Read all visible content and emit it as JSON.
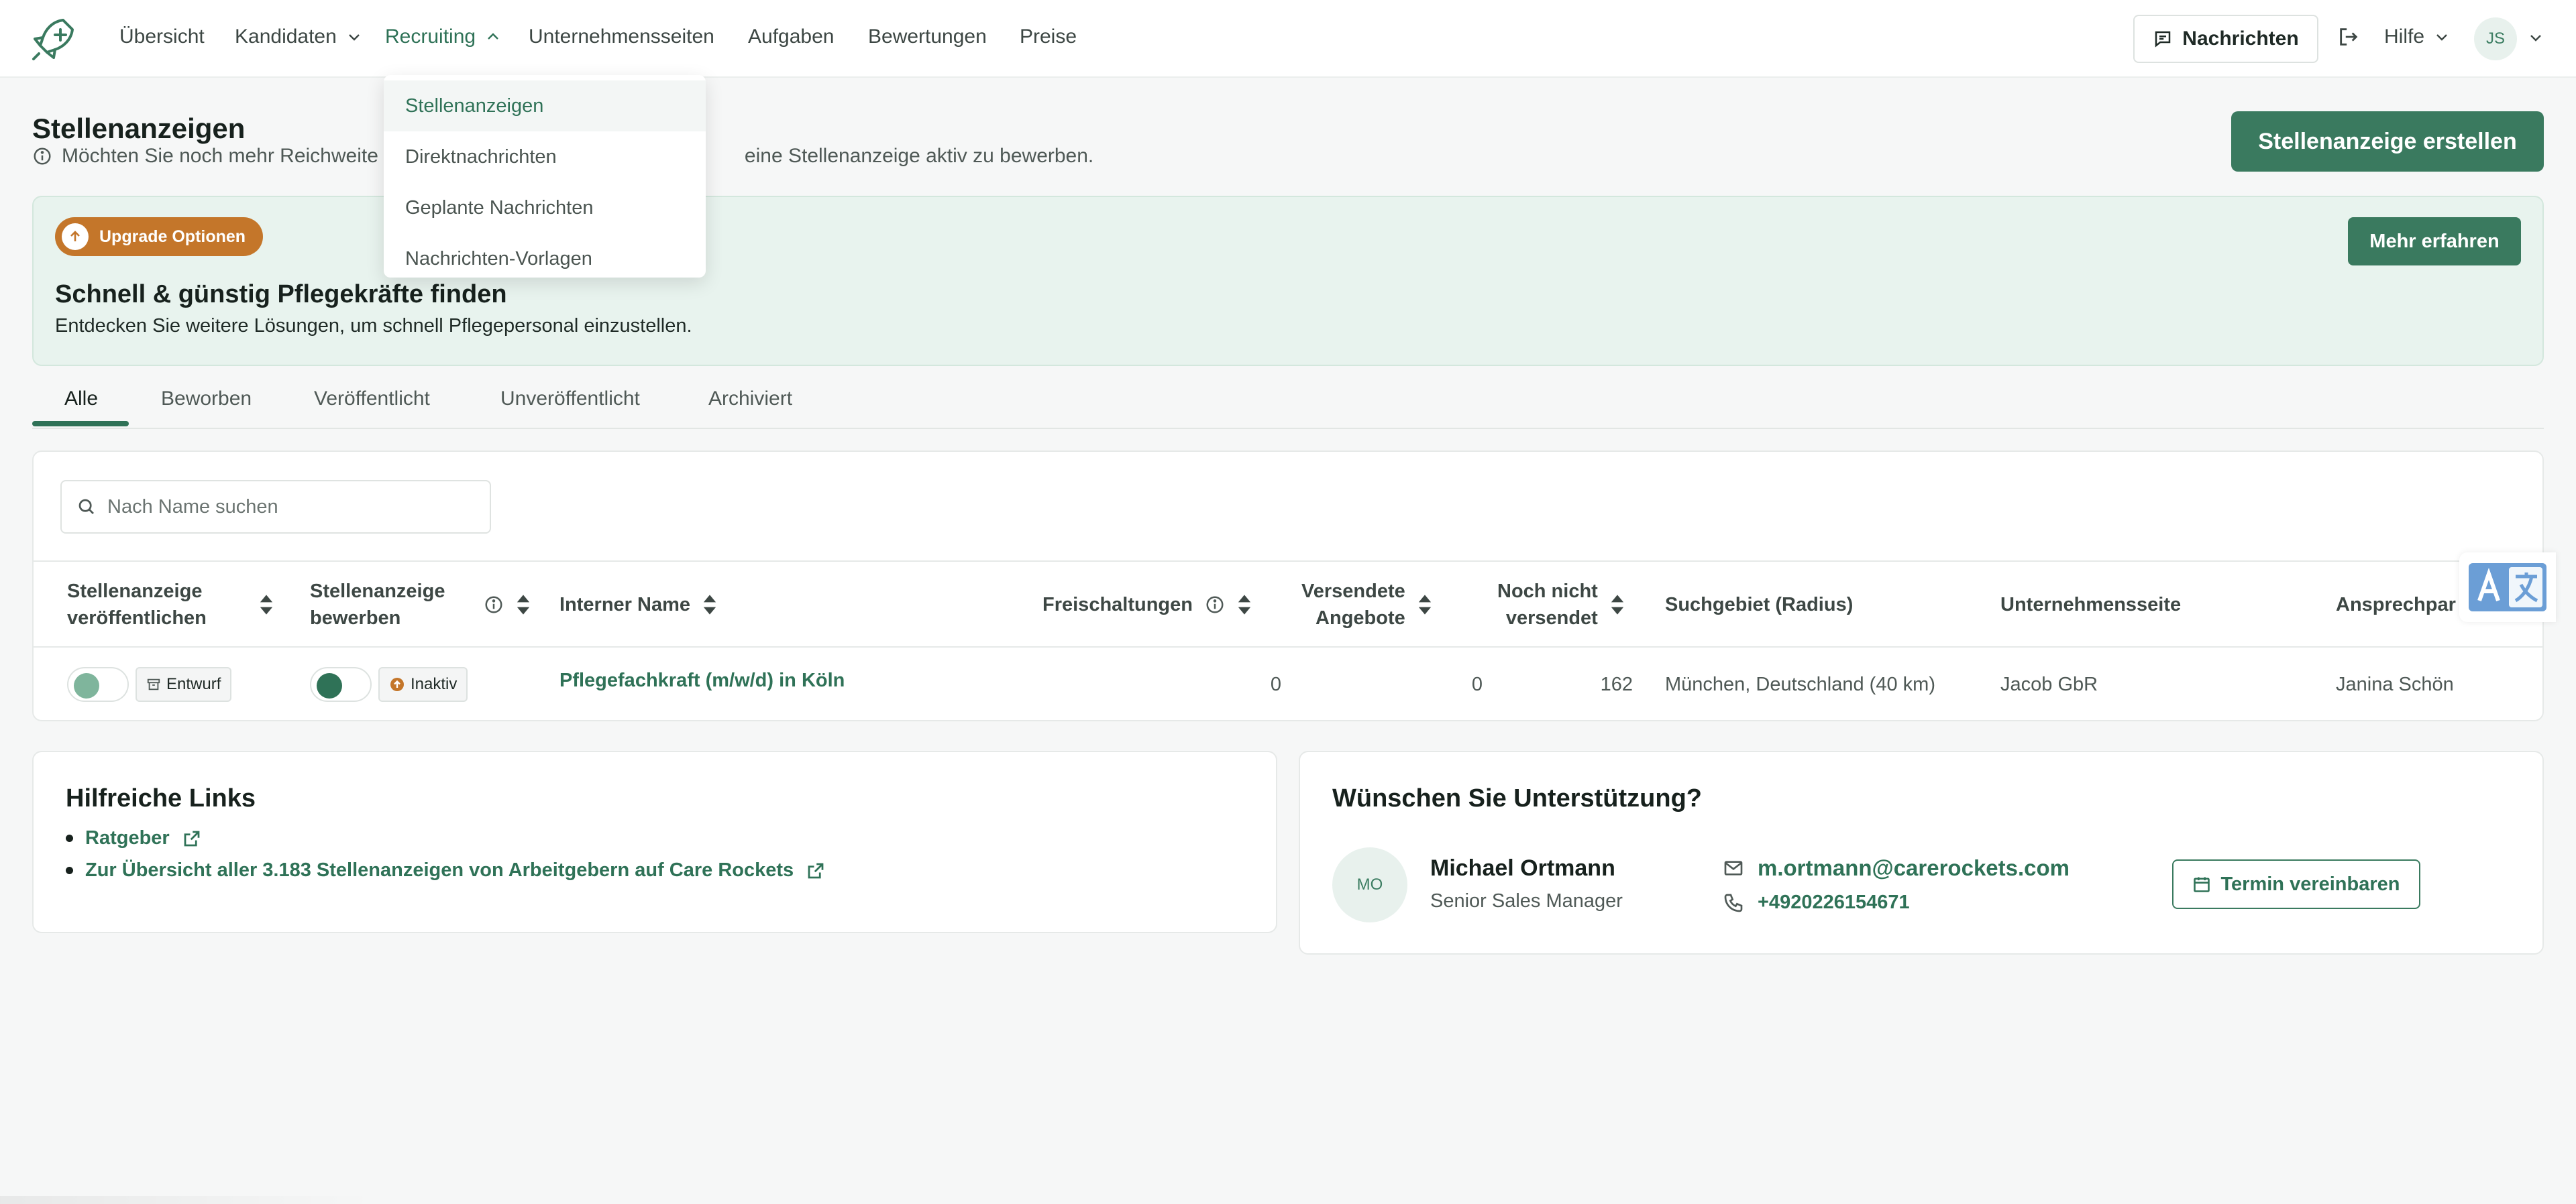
{
  "nav": {
    "items": [
      {
        "label": "Übersicht"
      },
      {
        "label": "Kandidaten"
      },
      {
        "label": "Recruiting"
      },
      {
        "label": "Unternehmensseiten"
      },
      {
        "label": "Aufgaben"
      },
      {
        "label": "Bewertungen"
      },
      {
        "label": "Preise"
      }
    ],
    "messages_label": "Nachrichten",
    "help_label": "Hilfe",
    "user_initials": "JS"
  },
  "recruiting_menu": [
    {
      "label": "Stellenanzeigen",
      "selected": true
    },
    {
      "label": "Direktnachrichten"
    },
    {
      "label": "Geplante Nachrichten"
    },
    {
      "label": "Nachrichten-Vorlagen"
    }
  ],
  "header": {
    "title": "Stellenanzeigen",
    "info_start": "Möchten Sie noch mehr Reichweite zu",
    "info_end": "eine Stellenanzeige aktiv zu bewerben.",
    "create_label": "Stellenanzeige erstellen"
  },
  "banner": {
    "badge": "Upgrade Optionen",
    "title": "Schnell & günstig Pflegekräfte finden",
    "subtitle": "Entdecken Sie weitere Lösungen, um schnell Pflegepersonal einzustellen.",
    "more_label": "Mehr erfahren"
  },
  "tabs": [
    {
      "label": "Alle",
      "active": true
    },
    {
      "label": "Beworben"
    },
    {
      "label": "Veröffentlicht"
    },
    {
      "label": "Unveröffentlicht"
    },
    {
      "label": "Archiviert"
    }
  ],
  "table": {
    "search_placeholder": "Nach Name suchen",
    "headers": {
      "publish": [
        "Stellenanzeige",
        "veröffentlichen"
      ],
      "promote": [
        "Stellenanzeige",
        "bewerben"
      ],
      "internal_name": "Interner Name",
      "unlocks": "Freischaltungen",
      "sent_offers": [
        "Versendete",
        "Angebote"
      ],
      "not_sent": [
        "Noch nicht",
        "versendet"
      ],
      "search_area": "Suchgebiet (Radius)",
      "company_page": "Unternehmensseite",
      "contact": "Ansprechpar"
    },
    "rows": [
      {
        "publish_status": "Entwurf",
        "promote_status": "Inaktiv",
        "internal_name": "Pflegefachkraft (m/w/d) in Köln",
        "unlocks": "0",
        "sent_offers": "0",
        "not_sent": "162",
        "search_area": "München, Deutschland (40 km)",
        "company_page": "Jacob GbR",
        "contact": "Janina Schön"
      }
    ]
  },
  "links_card": {
    "title": "Hilfreiche Links",
    "links": [
      {
        "label": "Ratgeber"
      },
      {
        "label": "Zur Übersicht aller 3.183 Stellenanzeigen von Arbeitgebern auf Care Rockets"
      }
    ]
  },
  "support_card": {
    "title": "Wünschen Sie Unterstützung?",
    "initials": "MO",
    "name": "Michael Ortmann",
    "role": "Senior Sales Manager",
    "email": "m.ortmann@carerockets.com",
    "phone": "+4920226154671",
    "appointment_label": "Termin vereinbaren"
  },
  "colors": {
    "brand_green": "#3a7a5f",
    "link_green": "#2f7257",
    "upgrade_orange": "#c4762a",
    "banner_bg": "#e8f3ee"
  },
  "icons": [
    "rocket-logo-icon",
    "chevron-down-icon",
    "chevron-up-icon",
    "message-icon",
    "logout-icon",
    "info-icon",
    "arrow-up-icon",
    "search-icon",
    "sort-icon",
    "archive-icon",
    "external-link-icon",
    "mail-icon",
    "phone-icon",
    "calendar-icon",
    "translate-icon"
  ]
}
